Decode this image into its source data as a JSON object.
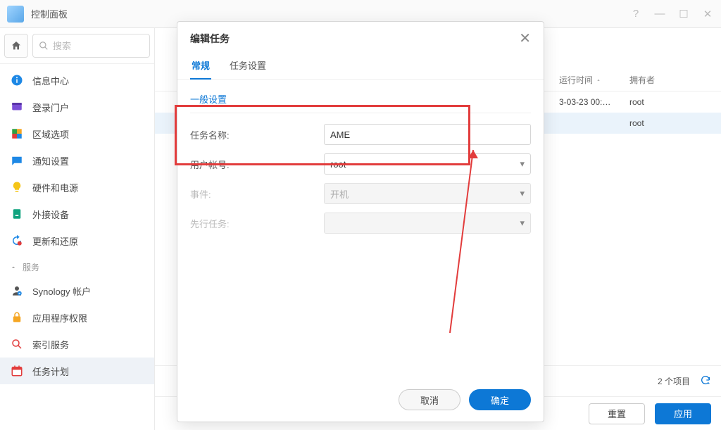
{
  "window": {
    "title": "控制面板"
  },
  "search": {
    "placeholder": "搜索"
  },
  "sidebar": {
    "items": [
      {
        "label": "信息中心",
        "icon": "info"
      },
      {
        "label": "登录门户",
        "icon": "portal"
      },
      {
        "label": "区域选项",
        "icon": "region"
      },
      {
        "label": "通知设置",
        "icon": "notify"
      },
      {
        "label": "硬件和电源",
        "icon": "power"
      },
      {
        "label": "外接设备",
        "icon": "external"
      },
      {
        "label": "更新和还原",
        "icon": "restore"
      }
    ],
    "group_label": "服务",
    "items2": [
      {
        "label": "Synology 帐户",
        "icon": "account"
      },
      {
        "label": "应用程序权限",
        "icon": "perm"
      },
      {
        "label": "索引服务",
        "icon": "index"
      },
      {
        "label": "任务计划",
        "icon": "task",
        "active": true
      }
    ]
  },
  "table": {
    "head": {
      "runtime": "运行时间",
      "owner": "拥有者"
    },
    "rows": [
      {
        "runtime": "3-03-23 00:…",
        "owner": "root"
      },
      {
        "runtime": "",
        "owner": "root",
        "selected": true
      }
    ]
  },
  "footer": {
    "count_label": "2 个项目"
  },
  "actions": {
    "reset": "重置",
    "apply": "应用"
  },
  "modal": {
    "title": "编辑任务",
    "tabs": {
      "general": "常规",
      "settings": "任务设置"
    },
    "section": "一般设置",
    "fields": {
      "task_name": {
        "label": "任务名称:",
        "value": "AME"
      },
      "user": {
        "label": "用户帐号:",
        "value": "root"
      },
      "event": {
        "label": "事件:",
        "value": "开机"
      },
      "pre_task": {
        "label": "先行任务:",
        "value": ""
      }
    },
    "buttons": {
      "cancel": "取消",
      "ok": "确定"
    }
  }
}
